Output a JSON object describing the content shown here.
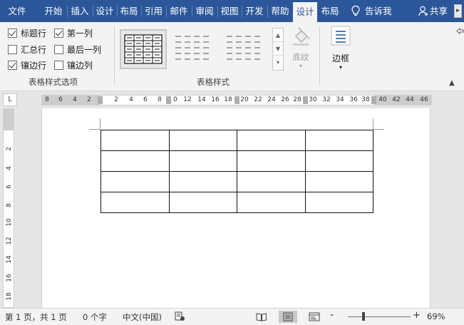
{
  "tabs": [
    {
      "label": "文件",
      "active": false
    },
    {
      "label": "开始",
      "active": false
    },
    {
      "label": "插入",
      "active": false
    },
    {
      "label": "设计",
      "active": false
    },
    {
      "label": "布局",
      "active": false
    },
    {
      "label": "引用",
      "active": false
    },
    {
      "label": "邮件",
      "active": false
    },
    {
      "label": "审阅",
      "active": false
    },
    {
      "label": "视图",
      "active": false
    },
    {
      "label": "开发",
      "active": false
    },
    {
      "label": "帮助",
      "active": false
    },
    {
      "label": "设计",
      "active": true
    },
    {
      "label": "布局",
      "active": false
    }
  ],
  "tellme": "告诉我",
  "share": "共享",
  "options": {
    "header_row": {
      "label": "标题行",
      "checked": true
    },
    "first_column": {
      "label": "第一列",
      "checked": true
    },
    "total_row": {
      "label": "汇总行",
      "checked": false
    },
    "last_column": {
      "label": "最后一列",
      "checked": false
    },
    "banded_rows": {
      "label": "镶边行",
      "checked": true
    },
    "banded_columns": {
      "label": "镶边列",
      "checked": false
    },
    "group_label": "表格样式选项"
  },
  "styles_group_label": "表格样式",
  "shading_label": "底纹",
  "borders_label": "边框",
  "ruler": {
    "h_ticks": [
      "8",
      "6",
      "4",
      "2",
      "2",
      "4",
      "6",
      "8",
      "0",
      "12",
      "14",
      "16",
      "18",
      "20",
      "22",
      "24",
      "26",
      "28",
      "30",
      "32",
      "34",
      "36",
      "38",
      "40",
      "42",
      "44",
      "46"
    ],
    "v_ticks": [
      "2",
      "4",
      "6",
      "8",
      "10",
      "12",
      "14",
      "16",
      "18"
    ],
    "corner": "L"
  },
  "table": {
    "rows": 4,
    "cols": 4
  },
  "status": {
    "page": "第 1 页，共 1 页",
    "words": "0 个字",
    "language": "中文(中国)",
    "zoom_minus": "-",
    "zoom_plus": "+",
    "zoom": "69%",
    "zoom_level": 0.23
  },
  "colors": {
    "ribbon_accent": "#2b579a"
  }
}
